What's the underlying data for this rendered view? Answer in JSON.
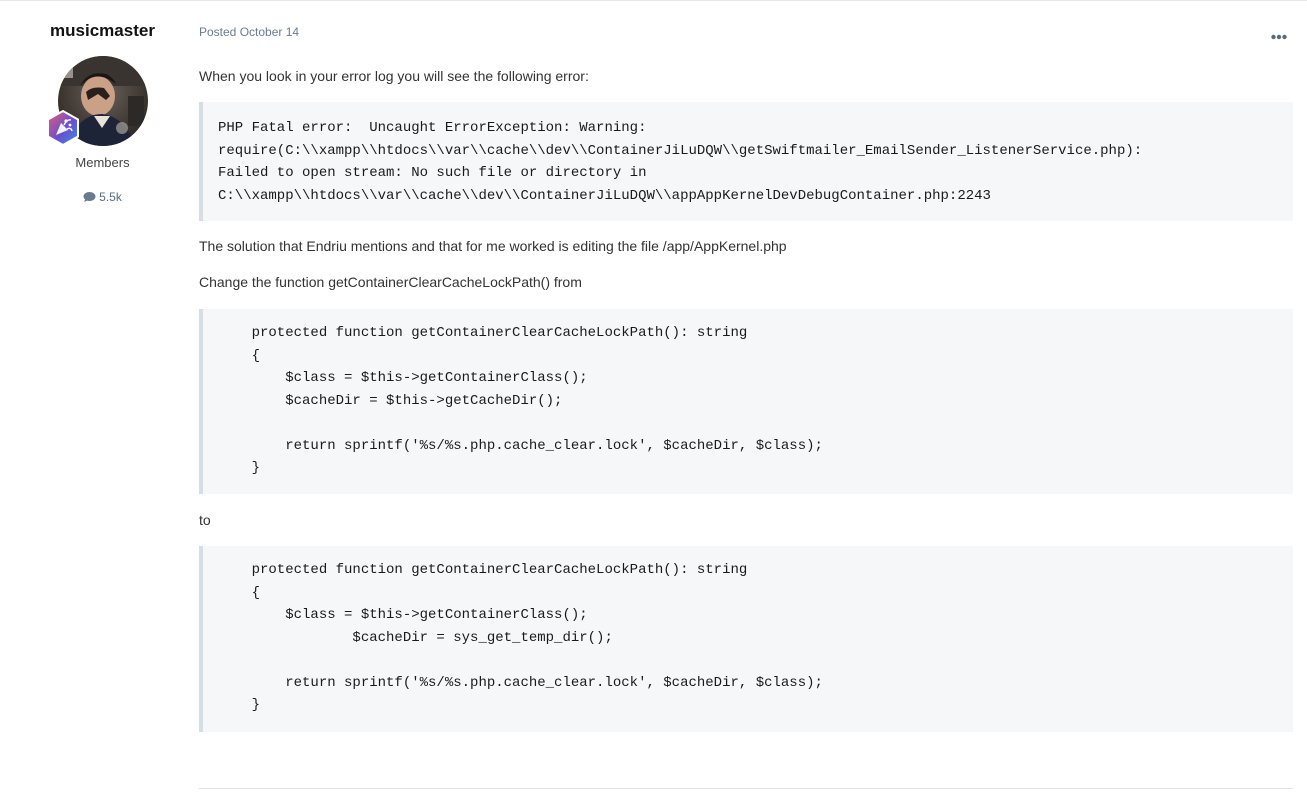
{
  "author": {
    "name": "musicmaster",
    "group": "Members",
    "post_count": "5.5k",
    "avatar_icon": "user-avatar-photo",
    "badge_icon": "rank-badge-icon",
    "badge_colors": [
      "#e85d75",
      "#5a4fcf",
      "#3a8ee6"
    ]
  },
  "post": {
    "meta": "Posted October 14",
    "more_icon": "ellipsis-icon",
    "intro": "When you look in your error log you will see the following error:",
    "error_code": "PHP Fatal error:  Uncaught ErrorException: Warning:\nrequire(C:\\\\xampp\\\\htdocs\\\\var\\\\cache\\\\dev\\\\ContainerJiLuDQW\\\\getSwiftmailer_EmailSender_ListenerService.php):\nFailed to open stream: No such file or directory in\nC:\\\\xampp\\\\htdocs\\\\var\\\\cache\\\\dev\\\\ContainerJiLuDQW\\\\appAppKernelDevDebugContainer.php:2243",
    "solution": "The solution that Endriu mentions and that for me worked is editing the file /app/AppKernel.php",
    "change_intro": "Change the function getContainerClearCacheLockPath() from",
    "code_before": "    protected function getContainerClearCacheLockPath(): string\n    {\n        $class = $this->getContainerClass();\n        $cacheDir = $this->getCacheDir();\n\n        return sprintf('%s/%s.php.cache_clear.lock', $cacheDir, $class);\n    }",
    "to_label": "to",
    "code_after": "    protected function getContainerClearCacheLockPath(): string\n    {\n        $class = $this->getContainerClass();\n                $cacheDir = sys_get_temp_dir();\n\n        return sprintf('%s/%s.php.cache_clear.lock', $cacheDir, $class);\n    }"
  }
}
